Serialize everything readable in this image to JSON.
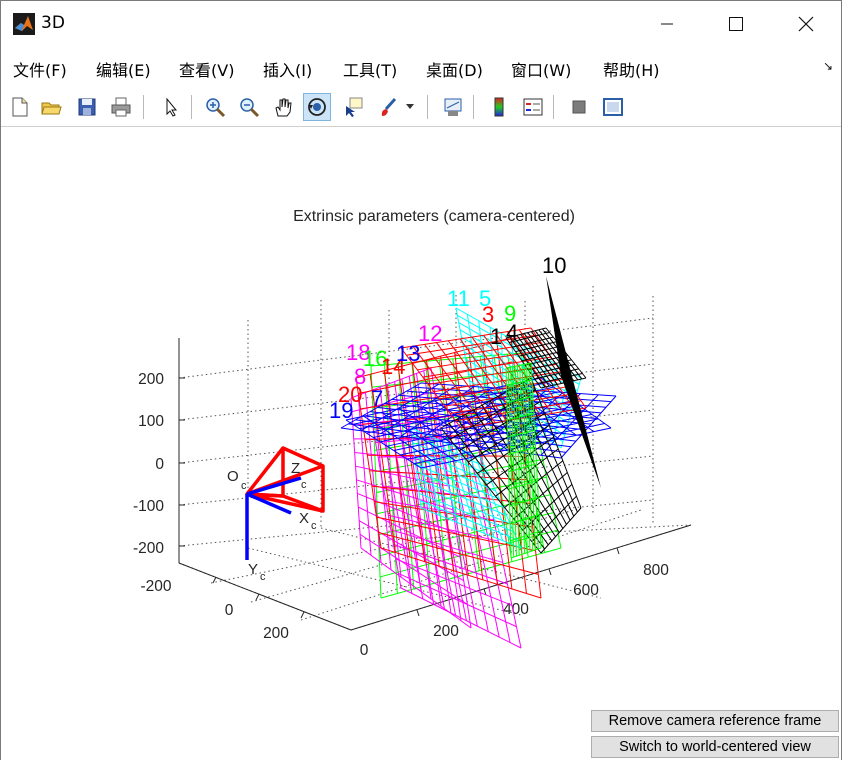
{
  "window": {
    "title": "3D",
    "controls": {
      "minimize": "minimize-icon",
      "maximize": "maximize-icon",
      "close": "close-icon"
    }
  },
  "menu": {
    "items": [
      "文件(F)",
      "编辑(E)",
      "查看(V)",
      "插入(I)",
      "工具(T)",
      "桌面(D)",
      "窗口(W)",
      "帮助(H)"
    ],
    "dock_icon": "↘"
  },
  "toolbar": {
    "buttons": [
      "new-figure-icon",
      "open-file-icon",
      "save-icon",
      "print-icon",
      "pointer-icon",
      "zoom-in-icon",
      "zoom-out-icon",
      "pan-hand-icon",
      "rotate-3d-icon",
      "data-cursor-icon",
      "brush-icon",
      "brush-dropdown-icon",
      "link-plot-icon",
      "colorbar-icon",
      "legend-icon",
      "hide-plot-tools-icon",
      "show-plot-tools-icon"
    ],
    "active": "rotate-3d-icon"
  },
  "plot": {
    "title": "Extrinsic parameters (camera-centered)",
    "z_ticks": [
      "200",
      "100",
      "0",
      "-100",
      "-200"
    ],
    "x_ticks": [
      "-200",
      "0",
      "200"
    ],
    "y_ticks": [
      "0",
      "200",
      "400",
      "600",
      "800"
    ],
    "camera_labels": {
      "origin": "O",
      "origin_sub": "c",
      "x": "X",
      "x_sub": "c",
      "y": "Y",
      "y_sub": "c",
      "z": "Z",
      "z_sub": "c"
    },
    "grid_labels": [
      {
        "text": "10",
        "color": "#000000"
      },
      {
        "text": "11",
        "color": "#00ffff"
      },
      {
        "text": "5",
        "color": "#00ffff"
      },
      {
        "text": "3",
        "color": "#ff0000"
      },
      {
        "text": "9",
        "color": "#00ff00"
      },
      {
        "text": "1",
        "color": "#000000"
      },
      {
        "text": "4",
        "color": "#000000"
      },
      {
        "text": "12",
        "color": "#ff00ff"
      },
      {
        "text": "18",
        "color": "#ff00ff"
      },
      {
        "text": "16",
        "color": "#00ff00"
      },
      {
        "text": "14",
        "color": "#ff0000"
      },
      {
        "text": "13",
        "color": "#0000ff"
      },
      {
        "text": "8",
        "color": "#ff00ff"
      },
      {
        "text": "20",
        "color": "#ff0000"
      },
      {
        "text": "7",
        "color": "#0000ff"
      },
      {
        "text": "19",
        "color": "#0000ff"
      }
    ]
  },
  "buttons": {
    "remove_frame": "Remove camera reference frame",
    "switch_view": "Switch to world-centered view"
  }
}
